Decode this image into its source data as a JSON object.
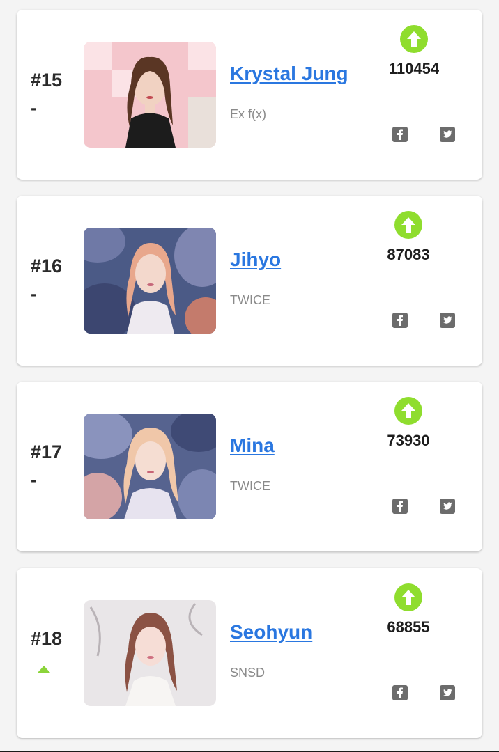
{
  "colors": {
    "vote_button": "#8fdd2e",
    "name_link": "#2a77e0",
    "rank_up_arrow": "#8bd43a",
    "share_icon": "#6c6c6c"
  },
  "entries": [
    {
      "rank": "#15",
      "change": "-",
      "name": "Krystal Jung",
      "group": "Ex f(x)",
      "votes": "110454",
      "vote_icon": "arrow-up-circle-icon",
      "share_icons": [
        "facebook-icon",
        "twitter-icon"
      ]
    },
    {
      "rank": "#16",
      "change": "-",
      "name": "Jihyo",
      "group": "TWICE",
      "votes": "87083",
      "vote_icon": "arrow-up-circle-icon",
      "share_icons": [
        "facebook-icon",
        "twitter-icon"
      ]
    },
    {
      "rank": "#17",
      "change": "-",
      "name": "Mina",
      "group": "TWICE",
      "votes": "73930",
      "vote_icon": "arrow-up-circle-icon",
      "share_icons": [
        "facebook-icon",
        "twitter-icon"
      ]
    },
    {
      "rank": "#18",
      "change": "up",
      "name": "Seohyun",
      "group": "SNSD",
      "votes": "68855",
      "vote_icon": "arrow-up-circle-icon",
      "share_icons": [
        "facebook-icon",
        "twitter-icon"
      ]
    }
  ]
}
